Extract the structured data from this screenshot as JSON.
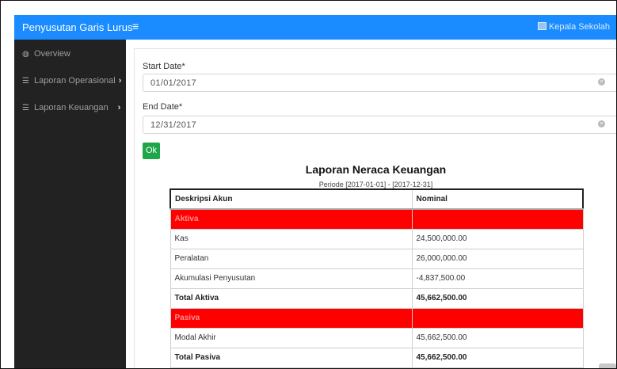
{
  "navbar": {
    "brand": "Penyusutan Garis Lurus",
    "menu_toggle": "≡",
    "user": "Kepala Sekolah"
  },
  "sidebar": {
    "items": [
      {
        "label": "Overview",
        "icon": "dashboard-icon"
      },
      {
        "label": "Laporan Operasional",
        "icon": "list-icon",
        "chevron": "›"
      },
      {
        "label": "Laporan Keuangan",
        "icon": "list-icon",
        "chevron": "›"
      }
    ]
  },
  "form": {
    "start_label": "Start Date*",
    "start_value": "01/01/2017",
    "end_label": "End Date*",
    "end_value": "12/31/2017",
    "ok_label": "Ok"
  },
  "report": {
    "title": "Laporan Neraca Keuangan",
    "period": "Periode [2017-01-01] - [2017-12-31]",
    "headers": [
      "Deskripsi Akun",
      "Nominal"
    ],
    "section_color": "#ff0000",
    "rows": [
      {
        "type": "section",
        "label": "Aktiva",
        "value": ""
      },
      {
        "type": "item",
        "label": "Kas",
        "value": "24,500,000.00"
      },
      {
        "type": "item",
        "label": "Peralatan",
        "value": "26,000,000.00"
      },
      {
        "type": "item",
        "label": "Akumulasi Penyusutan",
        "value": "-4,837,500.00"
      },
      {
        "type": "total",
        "label": "Total Aktiva",
        "value": "45,662,500.00"
      },
      {
        "type": "section",
        "label": "Pasiva",
        "value": ""
      },
      {
        "type": "item",
        "label": "Modal Akhir",
        "value": "45,662,500.00"
      },
      {
        "type": "total",
        "label": "Total Pasiva",
        "value": "45,662,500.00"
      }
    ]
  },
  "colors": {
    "navbar": "#1a8cff",
    "sidebar": "#222222",
    "ok_button": "#1fa64a"
  }
}
